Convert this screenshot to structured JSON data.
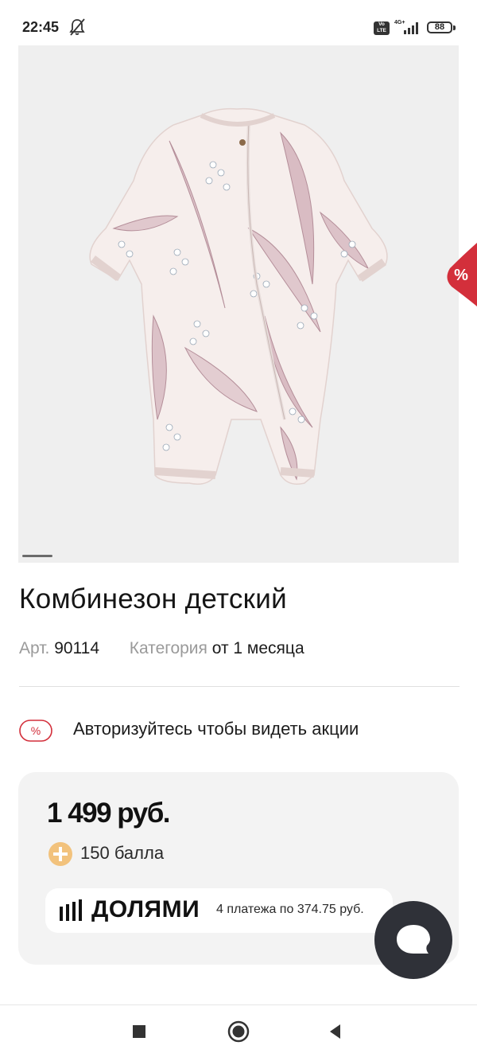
{
  "status_bar": {
    "time": "22:45",
    "volte": "Vo LTE",
    "network": "4G+",
    "battery": "88"
  },
  "product": {
    "title": "Комбинезон детский",
    "article_label": "Арт.",
    "article_value": "90114",
    "category_label": "Категория",
    "category_value": "от 1 месяца",
    "image_alt": "Baby jumpsuit with lily-of-the-valley print"
  },
  "promo": {
    "tab_icon": "%",
    "badge_icon": "%",
    "text": "Авторизуйтесь чтобы видеть акции"
  },
  "pricing": {
    "price": "1 499 руб.",
    "bonus": "150 балла",
    "installment_brand": "ДОЛЯМИ",
    "installment_info": "4 платежа по 374.75 руб."
  },
  "colors": {
    "accent_red": "#d32f3b",
    "bonus_orange": "#f2c27c",
    "card_bg": "#f3f3f3",
    "fab_bg": "#2f3138"
  },
  "icons": {
    "status": [
      "bell-off-icon",
      "volte-icon",
      "signal-icon",
      "battery-icon"
    ],
    "chat": "chat-bubble-icon",
    "nav": [
      "recent-apps-icon",
      "home-icon",
      "back-icon"
    ]
  }
}
